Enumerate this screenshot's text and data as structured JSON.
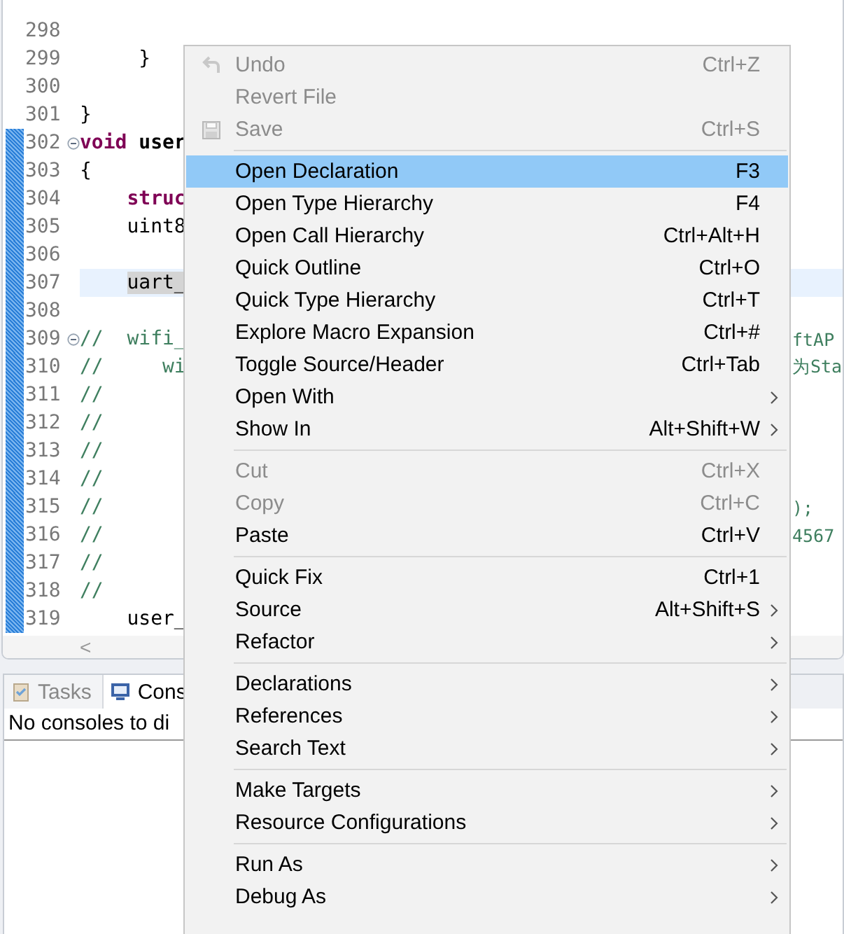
{
  "editor": {
    "lines": [
      {
        "number": "298",
        "changed": false,
        "fold": false,
        "current": false
      },
      {
        "number": "299",
        "changed": false,
        "fold": false,
        "current": false,
        "segments": [
          {
            "kind": "plain",
            "text": "     }"
          }
        ]
      },
      {
        "number": "300",
        "changed": false,
        "fold": false,
        "current": false
      },
      {
        "number": "301",
        "changed": false,
        "fold": false,
        "current": false,
        "segments": [
          {
            "kind": "plain",
            "text": "}"
          }
        ]
      },
      {
        "number": "302",
        "changed": true,
        "fold": true,
        "current": false,
        "segments": [
          {
            "kind": "keyword",
            "text": "void"
          },
          {
            "kind": "function",
            "text": " user"
          }
        ]
      },
      {
        "number": "303",
        "changed": true,
        "fold": false,
        "current": false,
        "segments": [
          {
            "kind": "plain",
            "text": "{"
          }
        ]
      },
      {
        "number": "304",
        "changed": true,
        "fold": false,
        "current": false,
        "segments": [
          {
            "kind": "keyword",
            "text": "    struc"
          }
        ]
      },
      {
        "number": "305",
        "changed": true,
        "fold": false,
        "current": false,
        "segments": [
          {
            "kind": "plain",
            "text": "    uint8"
          }
        ]
      },
      {
        "number": "306",
        "changed": true,
        "fold": false,
        "current": false
      },
      {
        "number": "307",
        "changed": true,
        "fold": false,
        "current": true,
        "segments": [
          {
            "kind": "occurrence",
            "text": "uart_"
          }
        ]
      },
      {
        "number": "308",
        "changed": true,
        "fold": false,
        "current": false
      },
      {
        "number": "309",
        "changed": true,
        "fold": true,
        "current": false,
        "segments": [
          {
            "kind": "comment",
            "text": "//  wifi_"
          }
        ],
        "tail": "ftAP"
      },
      {
        "number": "310",
        "changed": true,
        "fold": false,
        "current": false,
        "segments": [
          {
            "kind": "comment",
            "text": "//     wi"
          }
        ],
        "tail": "为Sta"
      },
      {
        "number": "311",
        "changed": true,
        "fold": false,
        "current": false,
        "segments": [
          {
            "kind": "comment",
            "text": "//"
          }
        ]
      },
      {
        "number": "312",
        "changed": true,
        "fold": false,
        "current": false,
        "segments": [
          {
            "kind": "comment",
            "text": "//"
          }
        ]
      },
      {
        "number": "313",
        "changed": true,
        "fold": false,
        "current": false,
        "segments": [
          {
            "kind": "comment",
            "text": "//"
          }
        ]
      },
      {
        "number": "314",
        "changed": true,
        "fold": false,
        "current": false,
        "segments": [
          {
            "kind": "comment",
            "text": "//"
          }
        ]
      },
      {
        "number": "315",
        "changed": true,
        "fold": false,
        "current": false,
        "segments": [
          {
            "kind": "comment",
            "text": "//"
          }
        ],
        "tail": ");"
      },
      {
        "number": "316",
        "changed": true,
        "fold": false,
        "current": false,
        "segments": [
          {
            "kind": "comment",
            "text": "//"
          }
        ],
        "tail": "4567"
      },
      {
        "number": "317",
        "changed": true,
        "fold": false,
        "current": false,
        "segments": [
          {
            "kind": "comment",
            "text": "//"
          }
        ]
      },
      {
        "number": "318",
        "changed": true,
        "fold": false,
        "current": false,
        "segments": [
          {
            "kind": "comment",
            "text": "//"
          }
        ]
      },
      {
        "number": "319",
        "changed": true,
        "fold": false,
        "current": false,
        "segments": [
          {
            "kind": "plain",
            "text": "    user_"
          }
        ]
      }
    ],
    "scroll_left": "<"
  },
  "panel": {
    "tabs": [
      {
        "label": "Tasks",
        "selected": false
      },
      {
        "label": "Cons",
        "selected": true
      }
    ],
    "message": "No consoles to di"
  },
  "context_menu": {
    "sections": [
      [
        {
          "label": "Undo",
          "shortcut": "Ctrl+Z",
          "disabled": true,
          "selected": false,
          "submenu": false
        },
        {
          "label": "Revert File",
          "disabled": true,
          "selected": false,
          "submenu": false
        },
        {
          "label": "Save",
          "shortcut": "Ctrl+S",
          "disabled": true,
          "selected": false,
          "submenu": false
        }
      ],
      [
        {
          "label": "Open Declaration",
          "shortcut": "F3",
          "disabled": false,
          "selected": true,
          "submenu": false
        },
        {
          "label": "Open Type Hierarchy",
          "shortcut": "F4",
          "disabled": false,
          "selected": false,
          "submenu": false
        },
        {
          "label": "Open Call Hierarchy",
          "shortcut": "Ctrl+Alt+H",
          "disabled": false,
          "selected": false,
          "submenu": false
        },
        {
          "label": "Quick Outline",
          "shortcut": "Ctrl+O",
          "disabled": false,
          "selected": false,
          "submenu": false
        },
        {
          "label": "Quick Type Hierarchy",
          "shortcut": "Ctrl+T",
          "disabled": false,
          "selected": false,
          "submenu": false
        },
        {
          "label": "Explore Macro Expansion",
          "shortcut": "Ctrl+#",
          "disabled": false,
          "selected": false,
          "submenu": false
        },
        {
          "label": "Toggle Source/Header",
          "shortcut": "Ctrl+Tab",
          "disabled": false,
          "selected": false,
          "submenu": false
        },
        {
          "label": "Open With",
          "disabled": false,
          "selected": false,
          "submenu": true
        },
        {
          "label": "Show In",
          "shortcut": "Alt+Shift+W",
          "disabled": false,
          "selected": false,
          "submenu": true
        }
      ],
      [
        {
          "label": "Cut",
          "shortcut": "Ctrl+X",
          "disabled": true,
          "selected": false,
          "submenu": false
        },
        {
          "label": "Copy",
          "shortcut": "Ctrl+C",
          "disabled": true,
          "selected": false,
          "submenu": false
        },
        {
          "label": "Paste",
          "shortcut": "Ctrl+V",
          "disabled": false,
          "selected": false,
          "submenu": false
        }
      ],
      [
        {
          "label": "Quick Fix",
          "shortcut": "Ctrl+1",
          "disabled": false,
          "selected": false,
          "submenu": false
        },
        {
          "label": "Source",
          "shortcut": "Alt+Shift+S",
          "disabled": false,
          "selected": false,
          "submenu": true
        },
        {
          "label": "Refactor",
          "disabled": false,
          "selected": false,
          "submenu": true
        }
      ],
      [
        {
          "label": "Declarations",
          "disabled": false,
          "selected": false,
          "submenu": true
        },
        {
          "label": "References",
          "disabled": false,
          "selected": false,
          "submenu": true
        },
        {
          "label": "Search Text",
          "disabled": false,
          "selected": false,
          "submenu": true
        }
      ],
      [
        {
          "label": "Make Targets",
          "disabled": false,
          "selected": false,
          "submenu": true
        },
        {
          "label": "Resource Configurations",
          "disabled": false,
          "selected": false,
          "submenu": true
        }
      ],
      [
        {
          "label": "Run As",
          "disabled": false,
          "selected": false,
          "submenu": true
        },
        {
          "label": "Debug As",
          "disabled": false,
          "selected": false,
          "submenu": true
        }
      ]
    ]
  }
}
